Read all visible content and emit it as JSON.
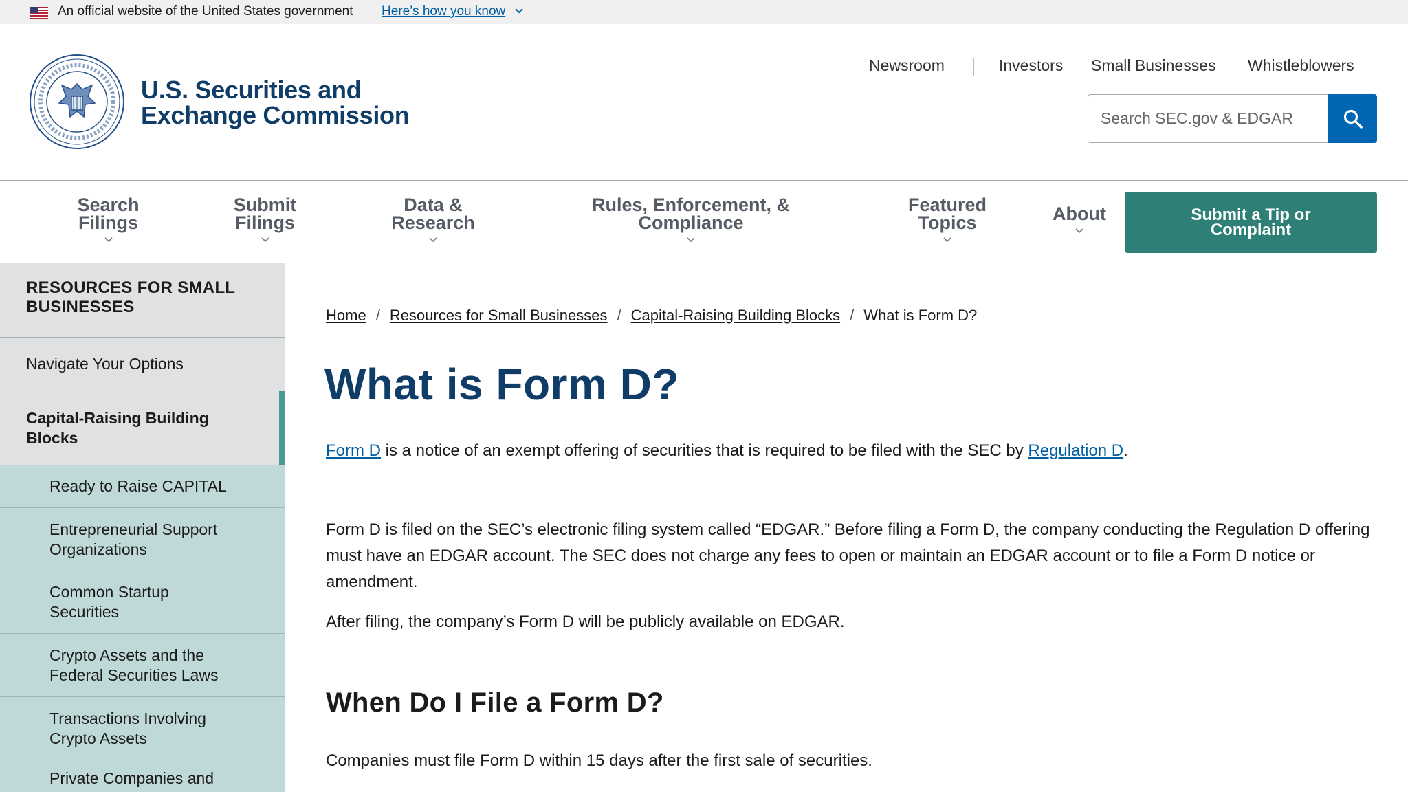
{
  "banner": {
    "text": "An official website of the United States government",
    "link": "Here’s how you know"
  },
  "logo": {
    "line1": "U.S. Securities and",
    "line2": "Exchange Commission"
  },
  "util_nav": [
    "Newsroom",
    "Investors",
    "Small Businesses",
    "Whistleblowers"
  ],
  "search": {
    "placeholder": "Search SEC.gov & EDGAR"
  },
  "main_nav": [
    {
      "line1": "Search",
      "line2": "Filings"
    },
    {
      "line1": "Submit",
      "line2": "Filings"
    },
    {
      "line1": "Data &",
      "line2": "Research"
    },
    {
      "line1": "Rules, Enforcement, &",
      "line2": "Compliance"
    },
    {
      "line1": "Featured",
      "line2": "Topics"
    },
    {
      "line1": "About",
      "line2": ""
    }
  ],
  "tip_button": {
    "line1": "Submit a Tip or",
    "line2": "Complaint"
  },
  "sidebar": {
    "heading_line1": "RESOURCES FOR SMALL",
    "heading_line2": "BUSINESSES",
    "item1": "Navigate Your Options",
    "active_line1": "Capital-Raising Building",
    "active_line2": "Blocks",
    "sub_items": [
      {
        "line1": "Ready to Raise CAPITAL",
        "line2": ""
      },
      {
        "line1": "Entrepreneurial Support",
        "line2": "Organizations"
      },
      {
        "line1": "Common Startup",
        "line2": "Securities"
      },
      {
        "line1": "Crypto Assets and the",
        "line2": "Federal Securities Laws"
      },
      {
        "line1": "Transactions Involving",
        "line2": "Crypto Assets"
      },
      {
        "line1": "Private Companies and",
        "line2": ""
      }
    ]
  },
  "breadcrumb": [
    "Home",
    "Resources for Small Businesses",
    "Capital-Raising Building Blocks",
    "What is Form D?"
  ],
  "page_title": "What is Form D?",
  "intro": {
    "link1": "Form D",
    "text": " is a notice of an exempt offering of securities that is required to be filed with the SEC by ",
    "link2": "Regulation D",
    "end": "."
  },
  "para2": "Form D is filed on the SEC’s electronic filing system called “EDGAR.” Before filing a Form D, the company conducting the Regulation D offering must have an EDGAR account. The SEC does not charge any fees to open or maintain an EDGAR account or to file a Form D notice or amendment.",
  "para3": "After filing, the company’s Form D will be publicly available on EDGAR.",
  "h2": "When Do I File a Form D?",
  "para4": "Companies must file Form D within 15 days after the first sale of securities.",
  "colors": {
    "brand_navy": "#0f3d67",
    "search_blue": "#0066b3",
    "tip_green": "#2e7f76",
    "sidebar_sub": "#bfd9d8",
    "link_blue": "#005ea2"
  }
}
